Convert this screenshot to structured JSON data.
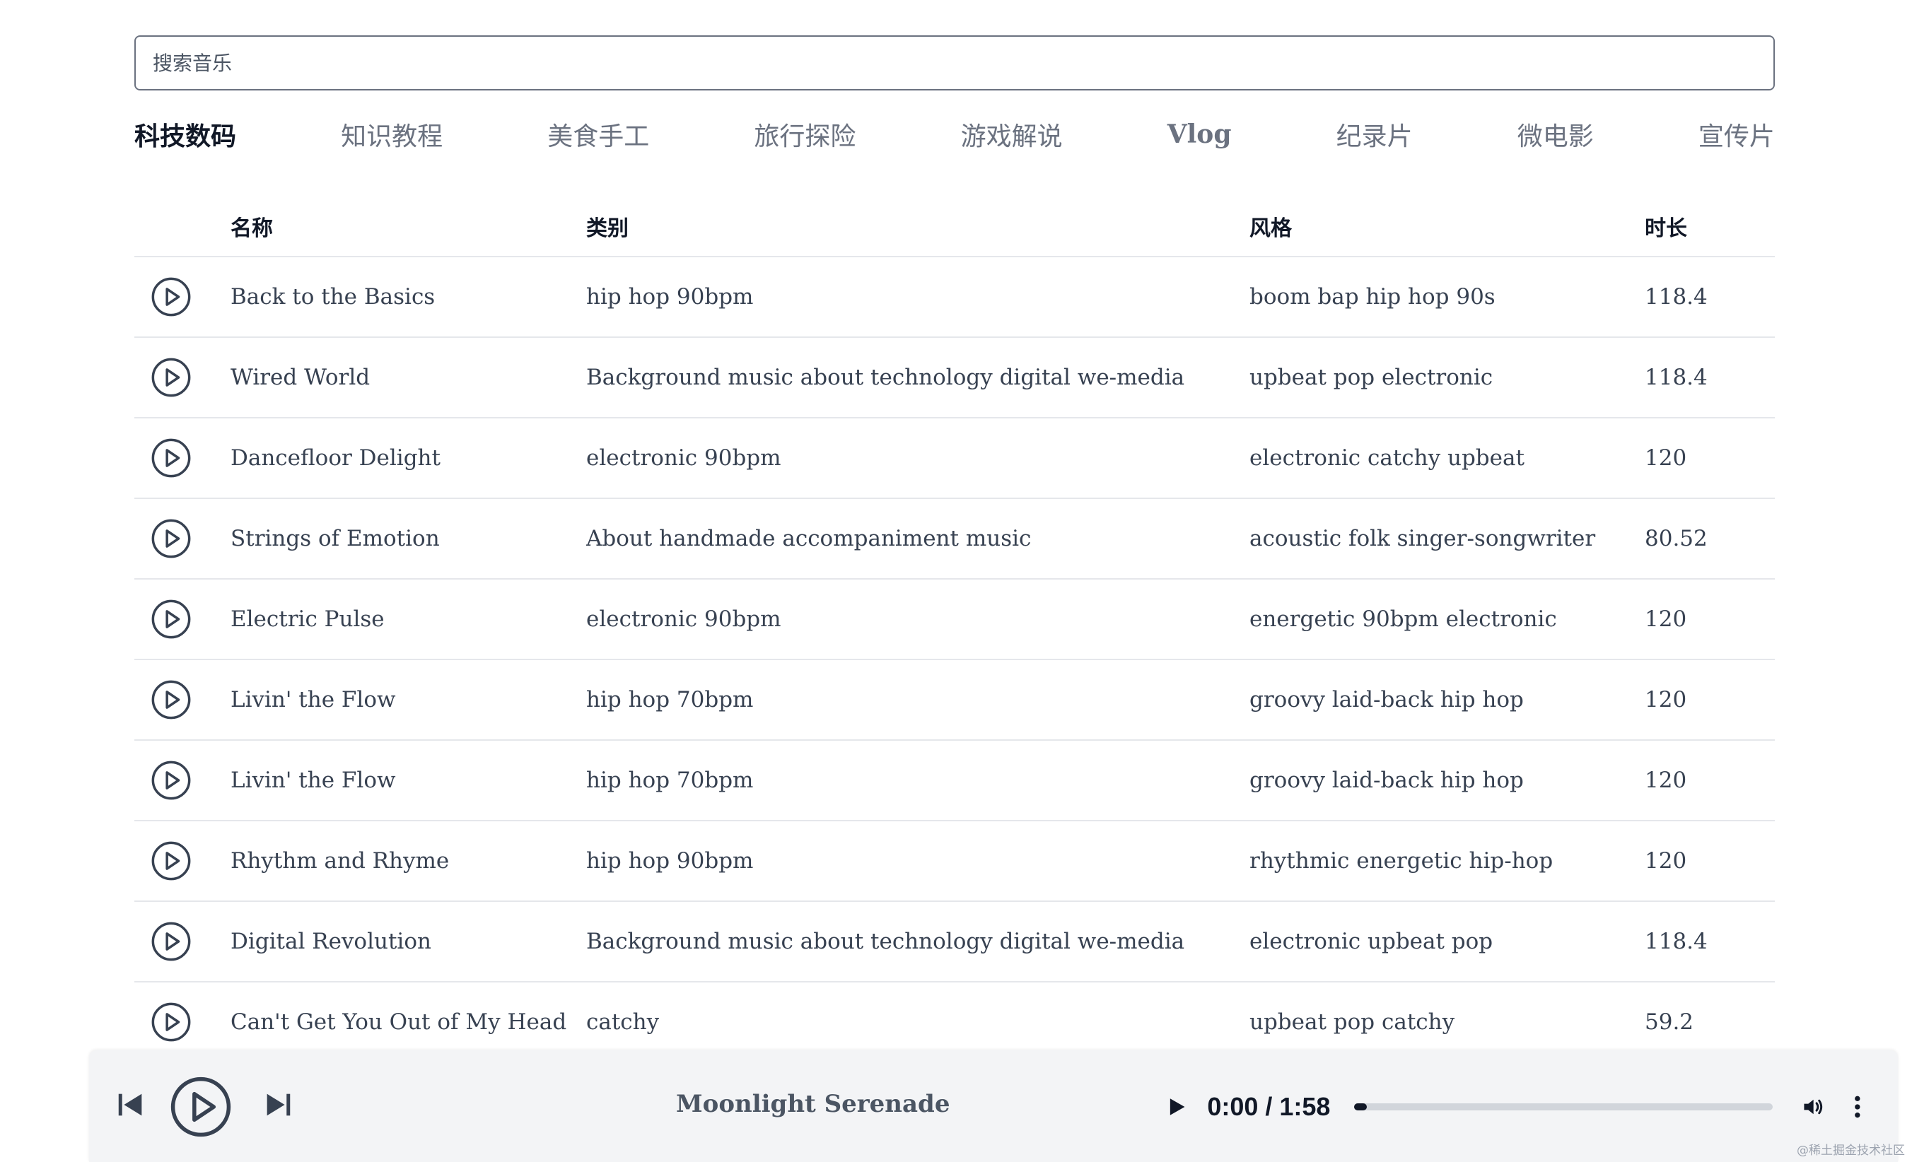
{
  "search": {
    "placeholder": "搜索音乐"
  },
  "tabs": [
    {
      "label": "科技数码",
      "active": true
    },
    {
      "label": "知识教程"
    },
    {
      "label": "美食手工"
    },
    {
      "label": "旅行探险"
    },
    {
      "label": "游戏解说"
    },
    {
      "label": "Vlog"
    },
    {
      "label": "纪录片"
    },
    {
      "label": "微电影"
    },
    {
      "label": "宣传片"
    }
  ],
  "table": {
    "headers": {
      "name": "名称",
      "category": "类别",
      "style": "风格",
      "duration": "时长"
    },
    "rows": [
      {
        "name": "Back to the Basics",
        "category": "hip hop 90bpm",
        "style": "boom bap hip hop 90s",
        "duration": "118.4"
      },
      {
        "name": "Wired World",
        "category": "Background music about technology digital we-media",
        "style": "upbeat pop electronic",
        "duration": "118.4"
      },
      {
        "name": "Dancefloor Delight",
        "category": "electronic 90bpm",
        "style": "electronic catchy upbeat",
        "duration": "120"
      },
      {
        "name": "Strings of Emotion",
        "category": "About handmade accompaniment music",
        "style": "acoustic folk singer-songwriter",
        "duration": "80.52"
      },
      {
        "name": "Electric Pulse",
        "category": "electronic 90bpm",
        "style": "energetic 90bpm electronic",
        "duration": "120"
      },
      {
        "name": "Livin' the Flow",
        "category": "hip hop 70bpm",
        "style": "groovy laid-back hip hop",
        "duration": "120"
      },
      {
        "name": "Livin' the Flow",
        "category": "hip hop 70bpm",
        "style": "groovy laid-back hip hop",
        "duration": "120"
      },
      {
        "name": "Rhythm and Rhyme",
        "category": "hip hop 90bpm",
        "style": "rhythmic energetic hip-hop",
        "duration": "120"
      },
      {
        "name": "Digital Revolution",
        "category": "Background music about technology digital we-media",
        "style": "electronic upbeat pop",
        "duration": "118.4"
      },
      {
        "name": "Can't Get You Out of My Head",
        "category": "catchy",
        "style": "upbeat pop catchy",
        "duration": "59.2"
      }
    ]
  },
  "player": {
    "title": "Moonlight Serenade",
    "time": "0:00 / 1:58",
    "progress": 0.03
  },
  "icons": {
    "row_play": "play-circle-icon",
    "prev": "skip-back-icon",
    "main_play": "play-circle-icon",
    "next": "skip-forward-icon",
    "audio_play": "play-icon",
    "volume": "volume-icon",
    "more": "more-vertical-icon"
  },
  "colors": {
    "text": "#374151",
    "muted": "#6b7280",
    "active": "#111827",
    "player_bg": "#f3f4f6",
    "border": "#e5e7eb"
  },
  "watermark": "@稀土掘金技术社区"
}
